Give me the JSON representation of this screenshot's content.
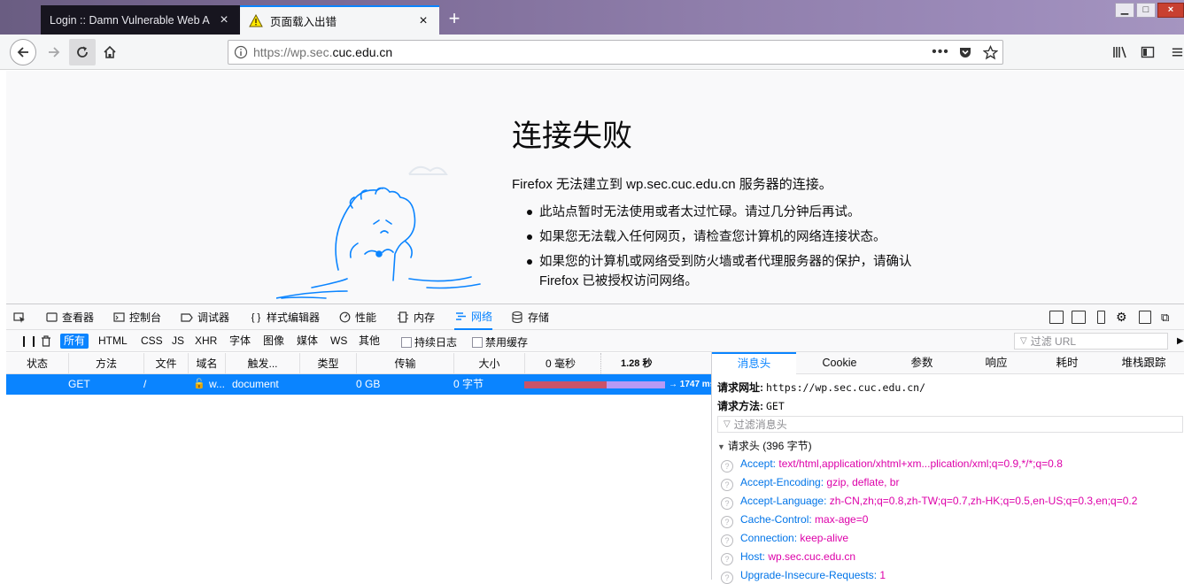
{
  "browser": {
    "tabs": [
      {
        "title": "Login :: Damn Vulnerable Web A",
        "active": false
      },
      {
        "title": "页面载入出错",
        "active": true
      }
    ],
    "url": {
      "prefix": "https://wp.sec.",
      "domain": "cuc.edu.cn"
    }
  },
  "error_page": {
    "title": "连接失败",
    "description": "Firefox 无法建立到 wp.sec.cuc.edu.cn 服务器的连接。",
    "items": [
      "此站点暂时无法使用或者太过忙碌。请过几分钟后再试。",
      "如果您无法载入任何网页，请检查您计算机的网络连接状态。",
      "如果您的计算机或网络受到防火墙或者代理服务器的保护，请确认 Firefox 已被授权访问网络。"
    ]
  },
  "devtools": {
    "tabs": [
      {
        "label": "查看器",
        "icon": "inspector-icon"
      },
      {
        "label": "控制台",
        "icon": "console-icon"
      },
      {
        "label": "调试器",
        "icon": "debugger-icon"
      },
      {
        "label": "样式编辑器",
        "icon": "style-editor-icon"
      },
      {
        "label": "性能",
        "icon": "performance-icon"
      },
      {
        "label": "内存",
        "icon": "memory-icon"
      },
      {
        "label": "网络",
        "icon": "network-icon",
        "selected": true
      },
      {
        "label": "存储",
        "icon": "storage-icon"
      }
    ],
    "filters": [
      "所有",
      "HTML",
      "CSS",
      "JS",
      "XHR",
      "字体",
      "图像",
      "媒体",
      "WS",
      "其他"
    ],
    "checkboxes": [
      "持续日志",
      "禁用缓存"
    ],
    "url_filter_placeholder": "过滤 URL",
    "columns": [
      "状态",
      "方法",
      "文件",
      "域名",
      "触发...",
      "类型",
      "传输",
      "大小",
      "0 毫秒",
      "1.28 秒"
    ],
    "request": {
      "method": "GET",
      "file": "/",
      "domain": "w...",
      "cause": "document",
      "transferred": "0 GB",
      "size": "0 字节",
      "timing": "→ 1747 ms"
    },
    "details": {
      "tabs": [
        "消息头",
        "Cookie",
        "参数",
        "响应",
        "耗时",
        "堆栈跟踪"
      ],
      "request_url_label": "请求网址:",
      "request_url": "https://wp.sec.cuc.edu.cn/",
      "request_method_label": "请求方法:",
      "request_method": "GET",
      "header_filter_placeholder": "过滤消息头",
      "request_headers_label": "请求头 (396 字节)",
      "headers": [
        {
          "name": "Accept:",
          "value": "text/html,application/xhtml+xm...plication/xml;q=0.9,*/*;q=0.8"
        },
        {
          "name": "Accept-Encoding:",
          "value": "gzip, deflate, br"
        },
        {
          "name": "Accept-Language:",
          "value": "zh-CN,zh;q=0.8,zh-TW;q=0.7,zh-HK;q=0.5,en-US;q=0.3,en;q=0.2"
        },
        {
          "name": "Cache-Control:",
          "value": "max-age=0"
        },
        {
          "name": "Connection:",
          "value": "keep-alive"
        },
        {
          "name": "Host:",
          "value": "wp.sec.cuc.edu.cn"
        },
        {
          "name": "Upgrade-Insecure-Requests:",
          "value": "1"
        }
      ]
    }
  }
}
